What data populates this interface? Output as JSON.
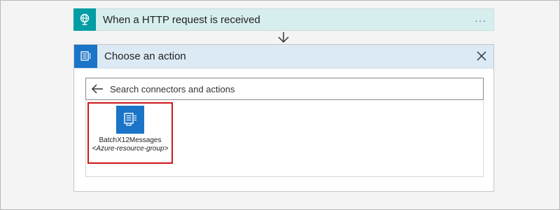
{
  "trigger": {
    "title": "When a HTTP request is received",
    "more_label": "···",
    "icon": "http-request-icon",
    "color": "#009da5"
  },
  "action": {
    "title": "Choose an action",
    "icon": "batch-icon",
    "color": "#1a74c8",
    "close_icon": "close-icon"
  },
  "search": {
    "placeholder": "Search connectors and actions",
    "value": ""
  },
  "results": [
    {
      "name": "BatchX12Messages",
      "subtitle": "<Azure-resource-group>",
      "icon": "batch-icon",
      "highlighted": true
    }
  ]
}
